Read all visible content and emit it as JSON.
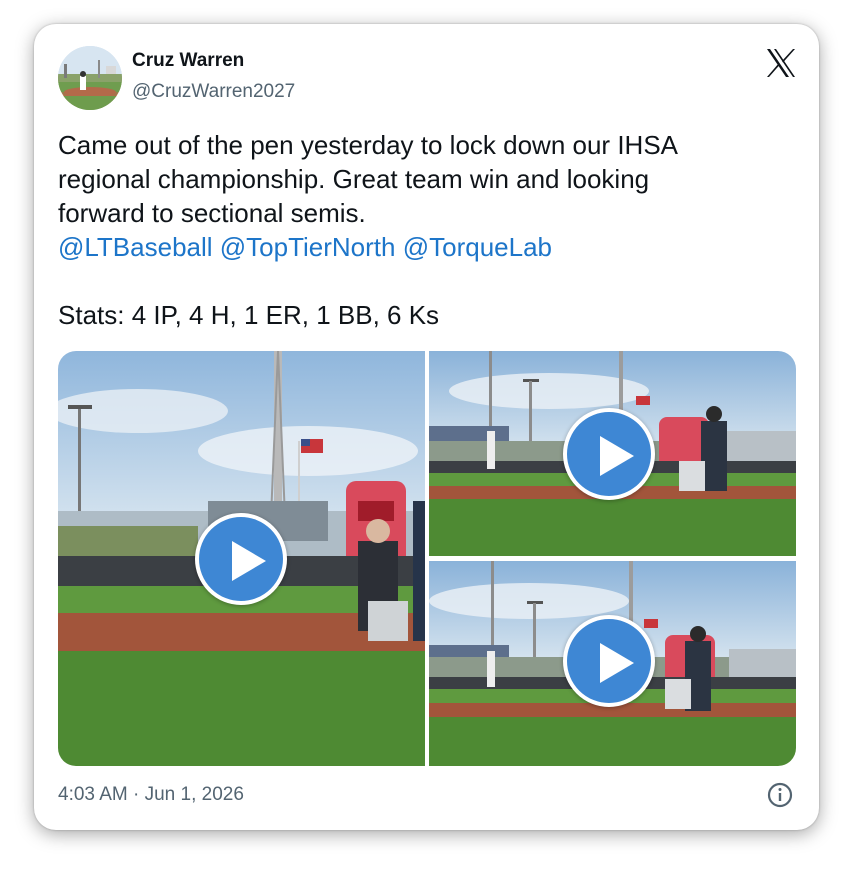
{
  "tweet": {
    "user_name": "Cruz Warren",
    "user_handle": "@CruzWarren2027",
    "text_lines": [
      "Came out of the pen yesterday to lock down our IHSA",
      "regional championship. Great team win and looking",
      "forward to sectional semis."
    ],
    "mentions": [
      "@LTBaseball",
      "@TopTierNorth",
      "@TorqueLab"
    ],
    "stats": "Stats: 4 IP, 4 H, 1 ER, 1 BB, 6 Ks",
    "timestamp": "4:03 AM · Jun 1, 2026"
  },
  "icons": {
    "brand": "x-logo-icon",
    "info": "info-icon",
    "play": "play-icon"
  },
  "colors": {
    "mention": "#1d75c9",
    "play_button": "#3e87d4",
    "text": "#0f1419",
    "muted": "#536471"
  },
  "media": {
    "count": 3,
    "type": "video"
  }
}
